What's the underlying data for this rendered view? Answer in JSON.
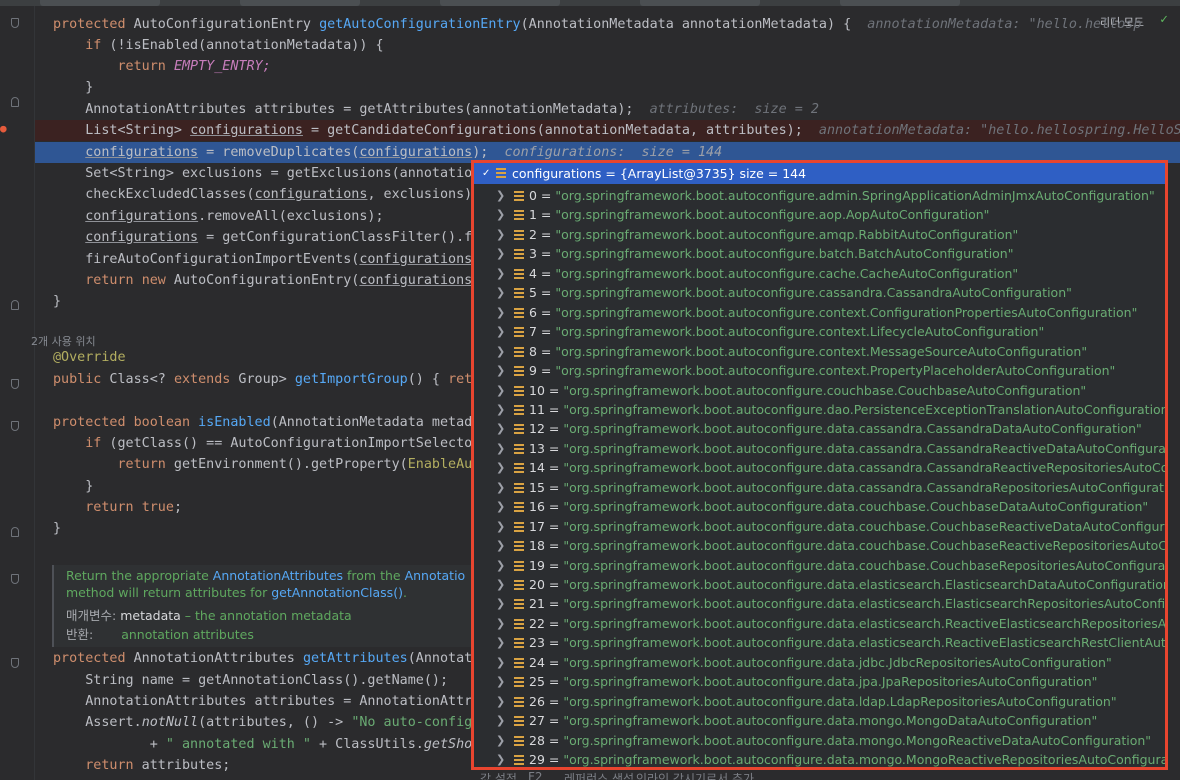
{
  "toolbar": {
    "reader_mode": "리더 모드",
    "check_icon": "check-icon"
  },
  "code": {
    "l1": {
      "kw": "protected",
      "type": "AutoConfigurationEntry",
      "name": "getAutoConfigurationEntry",
      "params": "(AnnotationMetadata annotationMetadata) {",
      "hint": "annotationMetadata: \"hello.hellosp"
    },
    "l2": {
      "kw": "if",
      "rest": " (!isEnabled(annotationMetadata)) {"
    },
    "l3": {
      "kw": "return",
      "rest": "EMPTY_ENTRY;"
    },
    "l4": "}",
    "l5": {
      "a": "AnnotationAttributes attributes = getAttributes(annotationMetadata);",
      "hint": "attributes:  size = 2"
    },
    "l6": {
      "a": "List<String> ",
      "u": "configurations",
      "b": " = getCandidateConfigurations(annotationMetadata, attributes);",
      "hint": "annotationMetadata: \"hello.hellospring.HelloSpringApp"
    },
    "l7": {
      "u": "configurations",
      "a": " = removeDuplicates(",
      "u2": "configurations",
      "b": ");",
      "hint": "configurations:  size = 144"
    },
    "l8": "Set<String> exclusions = getExclusions(annotationMe",
    "l9": {
      "a": "checkExcludedClasses(",
      "u": "configurations",
      "b": ", exclusions);"
    },
    "l10": {
      "u": "configurations",
      "b": ".removeAll(exclusions);"
    },
    "l11": {
      "u": "configurations",
      "b": " = getConfigurationClassFilter().filt"
    },
    "l12": {
      "a": "fireAutoConfigurationImportEvents(",
      "u": "configurations",
      "b": ", e"
    },
    "l13": {
      "kw": "return",
      "kw2": "new",
      "a": " AutoConfigurationEntry(",
      "u": "configurations",
      "b": ", e"
    },
    "l14": "}",
    "usages": "2개 사용 위치",
    "l15": "@Override",
    "l16": {
      "kw": "public",
      "a": " Class<? ",
      "kw2": "extends",
      "b": " Group> ",
      "fn": "getImportGroup",
      "c": "() { ",
      "kw3": "return"
    },
    "l17": {
      "kw": "protected",
      "kw2": "boolean",
      "fn": "isEnabled",
      "a": "(AnnotationMetadata metadata"
    },
    "l18": {
      "kw": "if",
      "a": " (getClass() == AutoConfigurationImportSelector.c"
    },
    "l19": {
      "kw": "return",
      "a": " getEnvironment().getProperty(",
      "ann": "EnableAutoC"
    },
    "l20": "}",
    "l21": {
      "kw": "return",
      "kw2": "true",
      "a": ";"
    },
    "l22": "}",
    "l23": {
      "kw": "protected",
      "a": " AnnotationAttributes ",
      "fn": "getAttributes",
      "b": "(Annotation"
    },
    "l24": "String name = getAnnotationClass().getName();",
    "l25": "AnnotationAttributes attributes = AnnotationAttribu",
    "l26": {
      "a": "Assert.",
      "it": "notNull",
      "b": "(attributes, () -> ",
      "str": "\"No auto-configura"
    },
    "l27": {
      "a": "+ ",
      "str": "\" annotated with \"",
      "b": " + ClassUtils.",
      "it": "getShortN"
    },
    "l28": {
      "kw": "return",
      "a": " attributes;"
    }
  },
  "doc": {
    "line1_a": "Return the appropriate ",
    "line1_link": "AnnotationAttributes",
    "line1_b": " from the ",
    "line1_link2": "Annotatio",
    "line2_a": "method will return attributes for ",
    "line2_link": "getAnnotationClass()",
    "line2_b": ".",
    "param_label": "매개변수:",
    "param_name": "metadata",
    "param_desc": " – the annotation metadata",
    "return_label": "반환:",
    "return_desc": "annotation attributes"
  },
  "popup": {
    "header": "configurations = {ArrayList@3735}  size = 144",
    "items": [
      {
        "idx": "0",
        "value": "\"org.springframework.boot.autoconfigure.admin.SpringApplicationAdminJmxAutoConfiguration\""
      },
      {
        "idx": "1",
        "value": "\"org.springframework.boot.autoconfigure.aop.AopAutoConfiguration\""
      },
      {
        "idx": "2",
        "value": "\"org.springframework.boot.autoconfigure.amqp.RabbitAutoConfiguration\""
      },
      {
        "idx": "3",
        "value": "\"org.springframework.boot.autoconfigure.batch.BatchAutoConfiguration\""
      },
      {
        "idx": "4",
        "value": "\"org.springframework.boot.autoconfigure.cache.CacheAutoConfiguration\""
      },
      {
        "idx": "5",
        "value": "\"org.springframework.boot.autoconfigure.cassandra.CassandraAutoConfiguration\""
      },
      {
        "idx": "6",
        "value": "\"org.springframework.boot.autoconfigure.context.ConfigurationPropertiesAutoConfiguration\""
      },
      {
        "idx": "7",
        "value": "\"org.springframework.boot.autoconfigure.context.LifecycleAutoConfiguration\""
      },
      {
        "idx": "8",
        "value": "\"org.springframework.boot.autoconfigure.context.MessageSourceAutoConfiguration\""
      },
      {
        "idx": "9",
        "value": "\"org.springframework.boot.autoconfigure.context.PropertyPlaceholderAutoConfiguration\""
      },
      {
        "idx": "10",
        "value": "\"org.springframework.boot.autoconfigure.couchbase.CouchbaseAutoConfiguration\""
      },
      {
        "idx": "11",
        "value": "\"org.springframework.boot.autoconfigure.dao.PersistenceExceptionTranslationAutoConfiguration\""
      },
      {
        "idx": "12",
        "value": "\"org.springframework.boot.autoconfigure.data.cassandra.CassandraDataAutoConfiguration\""
      },
      {
        "idx": "13",
        "value": "\"org.springframework.boot.autoconfigure.data.cassandra.CassandraReactiveDataAutoConfiguration\""
      },
      {
        "idx": "14",
        "value": "\"org.springframework.boot.autoconfigure.data.cassandra.CassandraReactiveRepositoriesAutoConfigu"
      },
      {
        "idx": "15",
        "value": "\"org.springframework.boot.autoconfigure.data.cassandra.CassandraRepositoriesAutoConfiguration\""
      },
      {
        "idx": "16",
        "value": "\"org.springframework.boot.autoconfigure.data.couchbase.CouchbaseDataAutoConfiguration\""
      },
      {
        "idx": "17",
        "value": "\"org.springframework.boot.autoconfigure.data.couchbase.CouchbaseReactiveDataAutoConfiguration\""
      },
      {
        "idx": "18",
        "value": "\"org.springframework.boot.autoconfigure.data.couchbase.CouchbaseReactiveRepositoriesAutoConfig"
      },
      {
        "idx": "19",
        "value": "\"org.springframework.boot.autoconfigure.data.couchbase.CouchbaseRepositoriesAutoConfiguration"
      },
      {
        "idx": "20",
        "value": "\"org.springframework.boot.autoconfigure.data.elasticsearch.ElasticsearchDataAutoConfiguration\""
      },
      {
        "idx": "21",
        "value": "\"org.springframework.boot.autoconfigure.data.elasticsearch.ElasticsearchRepositoriesAutoConfigura"
      },
      {
        "idx": "22",
        "value": "\"org.springframework.boot.autoconfigure.data.elasticsearch.ReactiveElasticsearchRepositoriesAutoCo"
      },
      {
        "idx": "23",
        "value": "\"org.springframework.boot.autoconfigure.data.elasticsearch.ReactiveElasticsearchRestClientAutoCon"
      },
      {
        "idx": "24",
        "value": "\"org.springframework.boot.autoconfigure.data.jdbc.JdbcRepositoriesAutoConfiguration\""
      },
      {
        "idx": "25",
        "value": "\"org.springframework.boot.autoconfigure.data.jpa.JpaRepositoriesAutoConfiguration\""
      },
      {
        "idx": "26",
        "value": "\"org.springframework.boot.autoconfigure.data.ldap.LdapRepositoriesAutoConfiguration\""
      },
      {
        "idx": "27",
        "value": "\"org.springframework.boot.autoconfigure.data.mongo.MongoDataAutoConfiguration\""
      },
      {
        "idx": "28",
        "value": "\"org.springframework.boot.autoconfigure.data.mongo.MongoReactiveDataAutoConfiguration\""
      },
      {
        "idx": "29",
        "value": "\"org.springframework.boot.autoconfigure.data.mongo.MongoReactiveRepositoriesAutoConfiguration\""
      }
    ]
  },
  "footer": {
    "a": "값 설정",
    "b": "F2",
    "c": "레퍼런스 생성",
    "d": "인라인 감시기로서 추가"
  }
}
